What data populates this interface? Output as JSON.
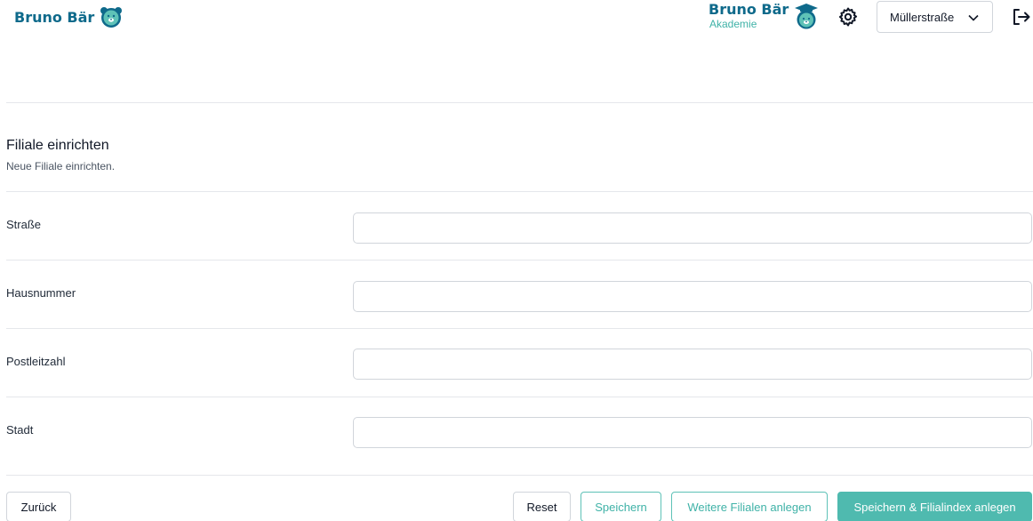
{
  "header": {
    "brand": "Bruno Bär",
    "academy_title": "Bruno Bär",
    "academy_sub": "Akademie",
    "branch_selected": "Müllerstraße",
    "colors": {
      "brand": "#0f6a8b",
      "accent": "#4fbaaf"
    }
  },
  "section": {
    "title": "Filiale einrichten",
    "subtitle": "Neue Filiale einrichten."
  },
  "form": {
    "fields": [
      {
        "label": "Straße",
        "value": "",
        "placeholder": ""
      },
      {
        "label": "Hausnummer",
        "value": "",
        "placeholder": ""
      },
      {
        "label": "Postleitzahl",
        "value": "",
        "placeholder": ""
      },
      {
        "label": "Stadt",
        "value": "",
        "placeholder": ""
      }
    ]
  },
  "actions": {
    "back": "Zurück",
    "reset": "Reset",
    "save": "Speichern",
    "more": "Weitere Filialen anlegen",
    "primary": "Speichern & Filialindex anlegen"
  }
}
